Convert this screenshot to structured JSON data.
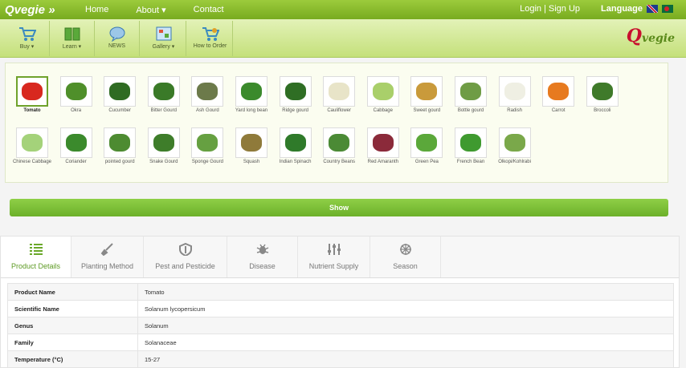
{
  "topnav": {
    "logo": "Qvegie »",
    "items": [
      "Home",
      "About ▾",
      "Contact"
    ],
    "login": "Login",
    "signup": "Sign Up",
    "language": "Language"
  },
  "toolbar": {
    "items": [
      {
        "label": "Buy ▾",
        "icon": "cart-icon"
      },
      {
        "label": "Learn ▾",
        "icon": "book-icon"
      },
      {
        "label": "NEWS",
        "icon": "speech-bubble-icon"
      },
      {
        "label": "Gallery ▾",
        "icon": "gallery-icon"
      },
      {
        "label": "How to Order",
        "icon": "cart-order-icon"
      }
    ],
    "brand_q": "Q",
    "brand_rest": "vegie"
  },
  "catalog": {
    "items": [
      {
        "label": "Tomato",
        "color": "#d8281f"
      },
      {
        "label": "Okra",
        "color": "#4f8f2a"
      },
      {
        "label": "Cucumber",
        "color": "#2f6b22"
      },
      {
        "label": "Bitter Gourd",
        "color": "#3a7a28"
      },
      {
        "label": "Ash Gourd",
        "color": "#6c7a4a"
      },
      {
        "label": "Yard long bean",
        "color": "#3b8a2c"
      },
      {
        "label": "Ridge gourd",
        "color": "#2f6e24"
      },
      {
        "label": "Cauliflower",
        "color": "#e8e4c8"
      },
      {
        "label": "Cabbage",
        "color": "#a9cf6a"
      },
      {
        "label": "Sweet gourd",
        "color": "#c99a3b"
      },
      {
        "label": "Bottle gourd",
        "color": "#6f9c45"
      },
      {
        "label": "Radish",
        "color": "#efefe3"
      },
      {
        "label": "Carrot",
        "color": "#e77a1f"
      },
      {
        "label": "Broccoli",
        "color": "#3f7a2a"
      },
      {
        "label": "Chinese Cabbage",
        "color": "#a4d27a"
      },
      {
        "label": "Coriander",
        "color": "#3b8a2c"
      },
      {
        "label": "pointed gourd",
        "color": "#4d8b31"
      },
      {
        "label": "Snake Gourd",
        "color": "#3e7d2a"
      },
      {
        "label": "Sponge Gourd",
        "color": "#66a041"
      },
      {
        "label": "Squash",
        "color": "#8f7a3a"
      },
      {
        "label": "Indian Spinach",
        "color": "#2f7a2a"
      },
      {
        "label": "Country Beans",
        "color": "#4b8a35"
      },
      {
        "label": "Red Amaranth",
        "color": "#8b2a3a"
      },
      {
        "label": "Green Pea",
        "color": "#5ba83a"
      },
      {
        "label": "French Bean",
        "color": "#3f9a2f"
      },
      {
        "label": "Olkopi/Kohlrabi",
        "color": "#7aa84a"
      }
    ],
    "show_label": "Show"
  },
  "details": {
    "tabs": [
      {
        "label": "Product Details",
        "icon": "list-icon"
      },
      {
        "label": "Planting Method",
        "icon": "shovel-icon"
      },
      {
        "label": "Pest and Pesticide",
        "icon": "shield-icon"
      },
      {
        "label": "Disease",
        "icon": "bug-icon"
      },
      {
        "label": "Nutrient Supply",
        "icon": "sliders-icon"
      },
      {
        "label": "Season",
        "icon": "snowflake-icon"
      }
    ],
    "rows": [
      {
        "key": "Product Name",
        "value": "Tomato"
      },
      {
        "key": "Scientific Name",
        "value": "Solanum lycopersicum"
      },
      {
        "key": "Genus",
        "value": "Solanum"
      },
      {
        "key": "Family",
        "value": "Solanaceae"
      },
      {
        "key": "Temperature (°C)",
        "value": "15-27"
      }
    ]
  },
  "colors": {
    "accent": "#78ab1f",
    "brand_red": "#c8102e"
  }
}
